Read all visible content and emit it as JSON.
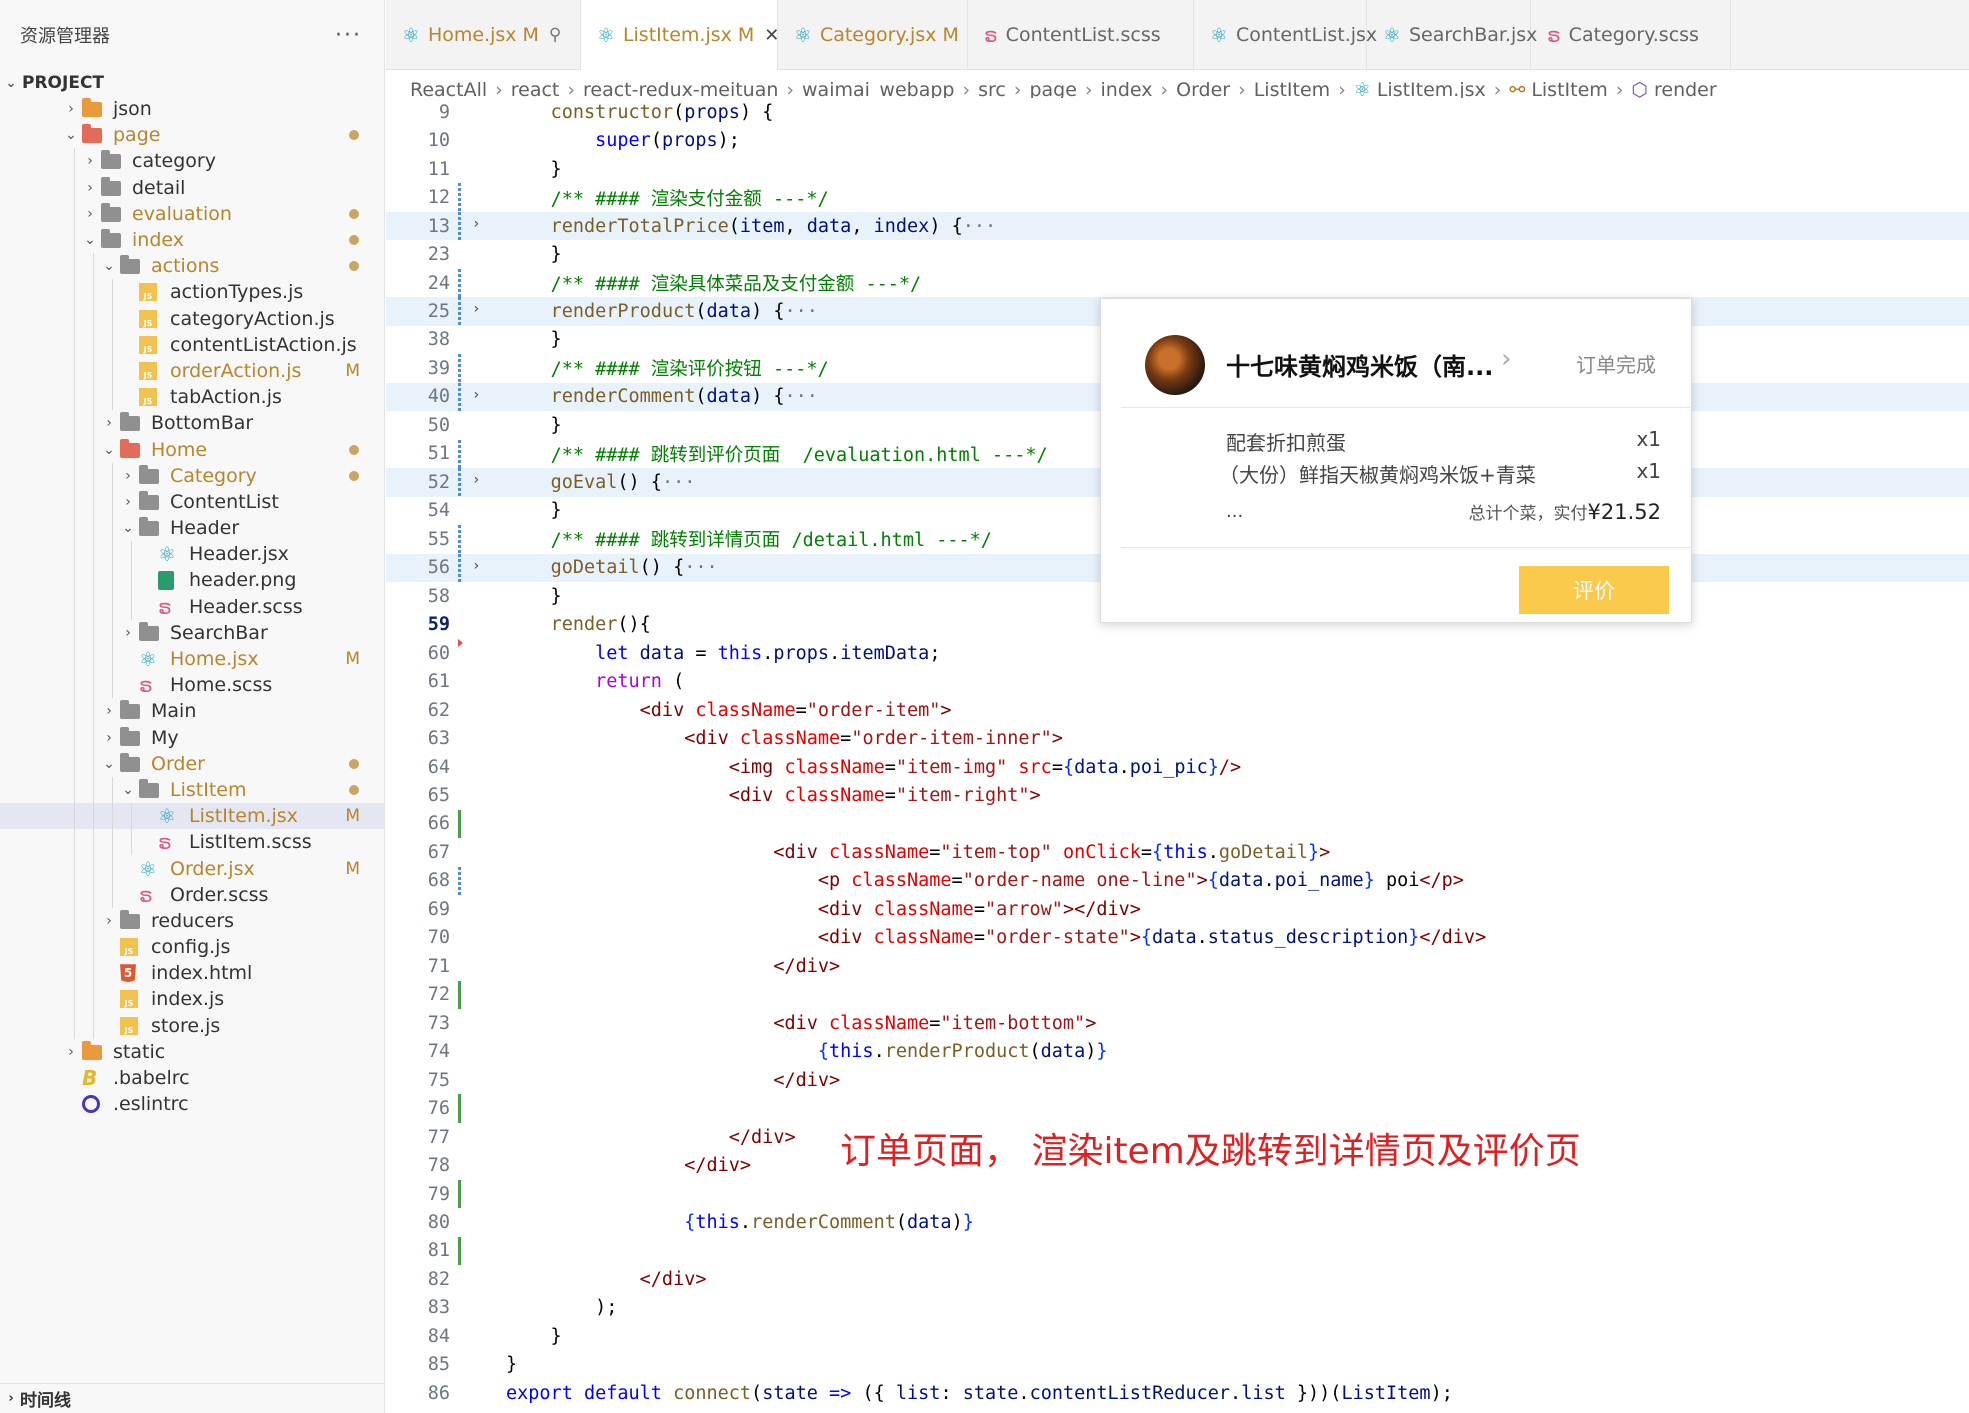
{
  "sidebar": {
    "title": "资源管理器",
    "more": "···",
    "section": "PROJECT",
    "bottom": "时间线",
    "tree": [
      {
        "label": "json",
        "indent": 1,
        "twisty": "›",
        "icon": "folder-orange",
        "mod": false
      },
      {
        "label": "page",
        "indent": 1,
        "twisty": "⌄",
        "icon": "folder-red",
        "dot": true,
        "mod": true
      },
      {
        "label": "category",
        "indent": 2,
        "twisty": "›",
        "icon": "folder"
      },
      {
        "label": "detail",
        "indent": 2,
        "twisty": "›",
        "icon": "folder"
      },
      {
        "label": "evaluation",
        "indent": 2,
        "twisty": "›",
        "icon": "folder",
        "dot": true,
        "mod": true
      },
      {
        "label": "index",
        "indent": 2,
        "twisty": "⌄",
        "icon": "folder",
        "dot": true,
        "mod": true
      },
      {
        "label": "actions",
        "indent": 3,
        "twisty": "⌄",
        "icon": "folder",
        "dot": true,
        "mod": true
      },
      {
        "label": "actionTypes.js",
        "indent": 4,
        "icon": "js"
      },
      {
        "label": "categoryAction.js",
        "indent": 4,
        "icon": "js"
      },
      {
        "label": "contentListAction.js",
        "indent": 4,
        "icon": "js"
      },
      {
        "label": "orderAction.js",
        "indent": 4,
        "icon": "js",
        "badge": "M",
        "mod": true
      },
      {
        "label": "tabAction.js",
        "indent": 4,
        "icon": "js"
      },
      {
        "label": "BottomBar",
        "indent": 3,
        "twisty": "›",
        "icon": "folder"
      },
      {
        "label": "Home",
        "indent": 3,
        "twisty": "⌄",
        "icon": "folder-red",
        "dot": true,
        "mod": true
      },
      {
        "label": "Category",
        "indent": 4,
        "twisty": "›",
        "icon": "folder",
        "dot": true,
        "mod": true
      },
      {
        "label": "ContentList",
        "indent": 4,
        "twisty": "›",
        "icon": "folder"
      },
      {
        "label": "Header",
        "indent": 4,
        "twisty": "⌄",
        "icon": "folder"
      },
      {
        "label": "Header.jsx",
        "indent": 5,
        "icon": "react"
      },
      {
        "label": "header.png",
        "indent": 5,
        "icon": "png"
      },
      {
        "label": "Header.scss",
        "indent": 5,
        "icon": "sass"
      },
      {
        "label": "SearchBar",
        "indent": 4,
        "twisty": "›",
        "icon": "folder"
      },
      {
        "label": "Home.jsx",
        "indent": 4,
        "icon": "react",
        "badge": "M",
        "mod": true
      },
      {
        "label": "Home.scss",
        "indent": 4,
        "icon": "sass"
      },
      {
        "label": "Main",
        "indent": 3,
        "twisty": "›",
        "icon": "folder"
      },
      {
        "label": "My",
        "indent": 3,
        "twisty": "›",
        "icon": "folder"
      },
      {
        "label": "Order",
        "indent": 3,
        "twisty": "⌄",
        "icon": "folder",
        "dot": true,
        "mod": true
      },
      {
        "label": "ListItem",
        "indent": 4,
        "twisty": "⌄",
        "icon": "folder",
        "dot": true,
        "mod": true
      },
      {
        "label": "ListItem.jsx",
        "indent": 5,
        "icon": "react",
        "badge": "M",
        "mod": true,
        "selected": true
      },
      {
        "label": "ListItem.scss",
        "indent": 5,
        "icon": "sass"
      },
      {
        "label": "Order.jsx",
        "indent": 4,
        "icon": "react",
        "badge": "M",
        "mod": true
      },
      {
        "label": "Order.scss",
        "indent": 4,
        "icon": "sass"
      },
      {
        "label": "reducers",
        "indent": 3,
        "twisty": "›",
        "icon": "folder"
      },
      {
        "label": "config.js",
        "indent": 3,
        "icon": "js"
      },
      {
        "label": "index.html",
        "indent": 3,
        "icon": "html"
      },
      {
        "label": "index.js",
        "indent": 3,
        "icon": "js"
      },
      {
        "label": "store.js",
        "indent": 3,
        "icon": "js"
      },
      {
        "label": "static",
        "indent": 1,
        "twisty": "›",
        "icon": "folder-orange"
      },
      {
        "label": ".babelrc",
        "indent": 1,
        "icon": "babel"
      },
      {
        "label": ".eslintrc",
        "indent": 1,
        "icon": "eslint"
      }
    ]
  },
  "tabs": [
    {
      "label": "Home.jsx",
      "icon": "react",
      "mod": "M",
      "extra": "pin",
      "modified": true
    },
    {
      "label": "ListItem.jsx",
      "icon": "react",
      "mod": "M",
      "extra": "close",
      "active": true,
      "modified": true
    },
    {
      "label": "Category.jsx",
      "icon": "react",
      "mod": "M",
      "modified": true
    },
    {
      "label": "ContentList.scss",
      "icon": "sass"
    },
    {
      "label": "ContentList.jsx",
      "icon": "react"
    },
    {
      "label": "SearchBar.jsx",
      "icon": "react"
    },
    {
      "label": "Category.scss",
      "icon": "sass"
    }
  ],
  "breadcrumb": [
    "ReactAll",
    "react",
    "react-redux-meituan",
    "waimai_webapp",
    "src",
    "page",
    "index",
    "Order",
    "ListItem",
    "ListItem.jsx",
    "ListItem",
    "render"
  ],
  "code": [
    {
      "n": "9",
      "g": "",
      "h": "    <span class=\"fn\">constructor</span>(<span class=\"v\">props</span>) {"
    },
    {
      "n": "10",
      "g": "",
      "h": "        <span class=\"k\">super</span>(<span class=\"v\">props</span>);"
    },
    {
      "n": "11",
      "g": "",
      "h": "    }"
    },
    {
      "n": "12",
      "g": "blue",
      "h": "    <span class=\"c\">/** #### 渲染支付金额 ---*/</span>"
    },
    {
      "n": "13",
      "g": "blue",
      "f": true,
      "hl": true,
      "h": "    <span class=\"fn\">renderTotalPrice</span>(<span class=\"v\">item</span>, <span class=\"v\">data</span>, <span class=\"v\">index</span>) {<span class=\"ellip\">···</span>"
    },
    {
      "n": "23",
      "g": "",
      "h": "    }"
    },
    {
      "n": "24",
      "g": "blue",
      "h": "    <span class=\"c\">/** #### 渲染具体菜品及支付金额 ---*/</span>"
    },
    {
      "n": "25",
      "g": "blue",
      "f": true,
      "hl": true,
      "h": "    <span class=\"fn\">renderProduct</span>(<span class=\"v\">data</span>) {<span class=\"ellip\">···</span>"
    },
    {
      "n": "38",
      "g": "",
      "h": "    }"
    },
    {
      "n": "39",
      "g": "blue",
      "h": "    <span class=\"c\">/** #### 渲染评价按钮 ---*/</span>"
    },
    {
      "n": "40",
      "g": "blue",
      "f": true,
      "hl": true,
      "h": "    <span class=\"fn\">renderComment</span>(<span class=\"v\">data</span>) {<span class=\"ellip\">···</span>"
    },
    {
      "n": "50",
      "g": "",
      "h": "    }"
    },
    {
      "n": "51",
      "g": "blue",
      "h": "    <span class=\"c\">/** #### 跳转到评价页面  /evaluation.html ---*/</span>"
    },
    {
      "n": "52",
      "g": "blue",
      "f": true,
      "hl": true,
      "h": "    <span class=\"fn\">goEval</span>() {<span class=\"ellip\">···</span>"
    },
    {
      "n": "54",
      "g": "",
      "h": "    }"
    },
    {
      "n": "55",
      "g": "blue",
      "h": "    <span class=\"c\">/** #### 跳转到详情页面 /detail.html ---*/</span>"
    },
    {
      "n": "56",
      "g": "blue",
      "f": true,
      "hl": true,
      "h": "    <span class=\"fn\">goDetail</span>() {<span class=\"ellip\">···</span>"
    },
    {
      "n": "58",
      "g": "",
      "h": "    }"
    },
    {
      "n": "59",
      "g": "",
      "cur": true,
      "h": "    <span class=\"fn\">render</span>(){"
    },
    {
      "n": "60",
      "g": "redtri",
      "h": "        <span class=\"k\">let</span> <span class=\"v\">data</span> = <span class=\"k\">this</span>.<span class=\"v\">props</span>.<span class=\"v\">itemData</span>;"
    },
    {
      "n": "61",
      "g": "",
      "h": "        <span class=\"pp\">return</span> ("
    },
    {
      "n": "62",
      "g": "",
      "h": "            <span class=\"tg\">&lt;div</span> <span class=\"at\">className</span>=<span class=\"s\">\"order-item\"</span><span class=\"tg\">&gt;</span>"
    },
    {
      "n": "63",
      "g": "",
      "h": "                <span class=\"tg\">&lt;div</span> <span class=\"at\">className</span>=<span class=\"s\">\"order-item-inner\"</span><span class=\"tg\">&gt;</span>"
    },
    {
      "n": "64",
      "g": "",
      "h": "                    <span class=\"tg\">&lt;img</span> <span class=\"at\">className</span>=<span class=\"s\">\"item-img\"</span> <span class=\"at\">src</span>=<span class=\"pu\">{</span><span class=\"v\">data</span>.<span class=\"v\">poi_pic</span><span class=\"pu\">}</span><span class=\"tg\">/&gt;</span>"
    },
    {
      "n": "65",
      "g": "",
      "h": "                    <span class=\"tg\">&lt;div</span> <span class=\"at\">className</span>=<span class=\"s\">\"item-right\"</span><span class=\"tg\">&gt;</span>"
    },
    {
      "n": "66",
      "g": "green",
      "h": ""
    },
    {
      "n": "67",
      "g": "",
      "h": "                        <span class=\"tg\">&lt;div</span> <span class=\"at\">className</span>=<span class=\"s\">\"item-top\"</span> <span class=\"at\">onClick</span>=<span class=\"pu\">{</span><span class=\"k\">this</span>.<span class=\"fn\">goDetail</span><span class=\"pu\">}</span><span class=\"tg\">&gt;</span>"
    },
    {
      "n": "68",
      "g": "blue",
      "h": "                            <span class=\"tg\">&lt;p</span> <span class=\"at\">className</span>=<span class=\"s\">\"order-name one-line\"</span><span class=\"tg\">&gt;</span><span class=\"pu\">{</span><span class=\"v\">data</span>.<span class=\"v\">poi_name</span><span class=\"pu\">}</span> poi<span class=\"tg\">&lt;/p&gt;</span>"
    },
    {
      "n": "69",
      "g": "",
      "h": "                            <span class=\"tg\">&lt;div</span> <span class=\"at\">className</span>=<span class=\"s\">\"arrow\"</span><span class=\"tg\">&gt;&lt;/div&gt;</span>"
    },
    {
      "n": "70",
      "g": "",
      "h": "                            <span class=\"tg\">&lt;div</span> <span class=\"at\">className</span>=<span class=\"s\">\"order-state\"</span><span class=\"tg\">&gt;</span><span class=\"pu\">{</span><span class=\"v\">data</span>.<span class=\"v\">status_description</span><span class=\"pu\">}</span><span class=\"tg\">&lt;/div&gt;</span>"
    },
    {
      "n": "71",
      "g": "",
      "h": "                        <span class=\"tg\">&lt;/div&gt;</span>"
    },
    {
      "n": "72",
      "g": "green",
      "h": ""
    },
    {
      "n": "73",
      "g": "",
      "h": "                        <span class=\"tg\">&lt;div</span> <span class=\"at\">className</span>=<span class=\"s\">\"item-bottom\"</span><span class=\"tg\">&gt;</span>"
    },
    {
      "n": "74",
      "g": "",
      "h": "                            <span class=\"pu\">{</span><span class=\"k\">this</span>.<span class=\"fn\">renderProduct</span>(<span class=\"v\">data</span>)<span class=\"pu\">}</span>"
    },
    {
      "n": "75",
      "g": "",
      "h": "                        <span class=\"tg\">&lt;/div&gt;</span>"
    },
    {
      "n": "76",
      "g": "green",
      "h": ""
    },
    {
      "n": "77",
      "g": "",
      "h": "                    <span class=\"tg\">&lt;/div&gt;</span>"
    },
    {
      "n": "78",
      "g": "",
      "h": "                <span class=\"tg\">&lt;/div&gt;</span>"
    },
    {
      "n": "79",
      "g": "green",
      "h": ""
    },
    {
      "n": "80",
      "g": "",
      "h": "                <span class=\"pu\">{</span><span class=\"k\">this</span>.<span class=\"fn\">renderComment</span>(<span class=\"v\">data</span>)<span class=\"pu\">}</span>"
    },
    {
      "n": "81",
      "g": "green",
      "h": ""
    },
    {
      "n": "82",
      "g": "",
      "h": "            <span class=\"tg\">&lt;/div&gt;</span>"
    },
    {
      "n": "83",
      "g": "",
      "h": "        );"
    },
    {
      "n": "84",
      "g": "",
      "h": "    }"
    },
    {
      "n": "85",
      "g": "",
      "h": "}"
    },
    {
      "n": "86",
      "g": "",
      "h": "<span class=\"k\">export</span> <span class=\"k\">default</span> <span class=\"fn\">connect</span>(<span class=\"v\">state</span> <span class=\"k\">=&gt;</span> ({ <span class=\"v\">list</span>: <span class=\"v\">state</span>.<span class=\"v\">contentListReducer</span>.<span class=\"v\">list</span> }))(<span class=\"v\">ListItem</span>);"
    }
  ],
  "preview": {
    "name": "十七味黄焖鸡米饭（南...",
    "state": "订单完成",
    "products": [
      {
        "name": "配套折扣煎蛋",
        "count": "x1"
      },
      {
        "name": "（大份）鲜指天椒黄焖鸡米饭+青菜",
        "count": "x1"
      }
    ],
    "more": "...",
    "total_label": "总计个菜，实付",
    "total_value": "¥21.52",
    "button": "评价"
  },
  "annotation": "订单页面，  渲染item及跳转到详情页及评价页"
}
